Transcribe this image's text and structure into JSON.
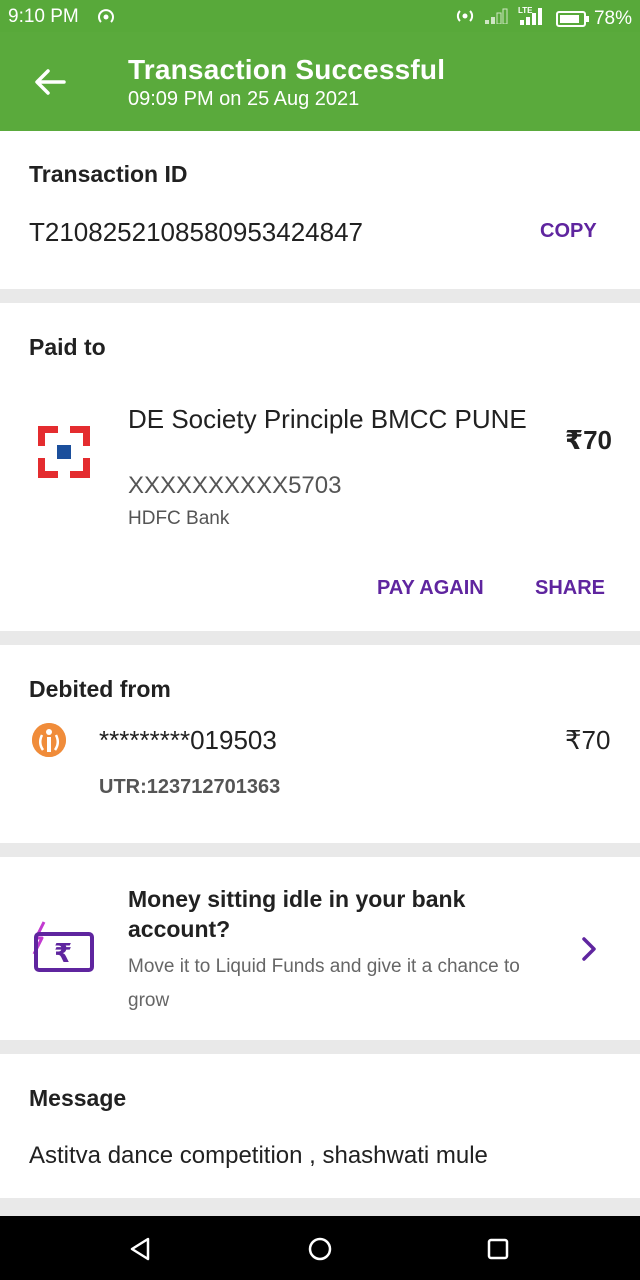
{
  "status_bar": {
    "time": "9:10 PM",
    "network": "LTE",
    "battery": "78%"
  },
  "header": {
    "title": "Transaction Successful",
    "subtitle": "09:09 PM on 25 Aug 2021",
    "color": "#5aaa3c"
  },
  "transaction": {
    "label": "Transaction ID",
    "id": "T2108252108580953424847",
    "copy_label": "COPY"
  },
  "paid_to": {
    "label": "Paid to",
    "name": "DE Society Principle BMCC PUNE",
    "account": "XXXXXXXXXX5703",
    "bank": "HDFC Bank",
    "amount": "₹70",
    "pay_again_label": "PAY AGAIN",
    "share_label": "SHARE",
    "icon": "hdfc-bank-logo-icon"
  },
  "debited_from": {
    "label": "Debited from",
    "account": "*********019503",
    "amount": "₹70",
    "utr": "UTR:123712701363",
    "icon": "idbi-bank-logo-icon"
  },
  "promo": {
    "title": "Money sitting idle in your bank account?",
    "subtitle": "Move it to Liquid Funds and give it a chance to grow",
    "icon": "rupee-wallet-icon"
  },
  "message": {
    "label": "Message",
    "text": "Astitva dance competition , shashwati mule"
  },
  "colors": {
    "accent": "#5f259f",
    "green": "#5aaa3c",
    "hdfc_red": "#e42c2f",
    "hdfc_blue": "#1b4f9c",
    "idbi_orange": "#f08c3a"
  }
}
